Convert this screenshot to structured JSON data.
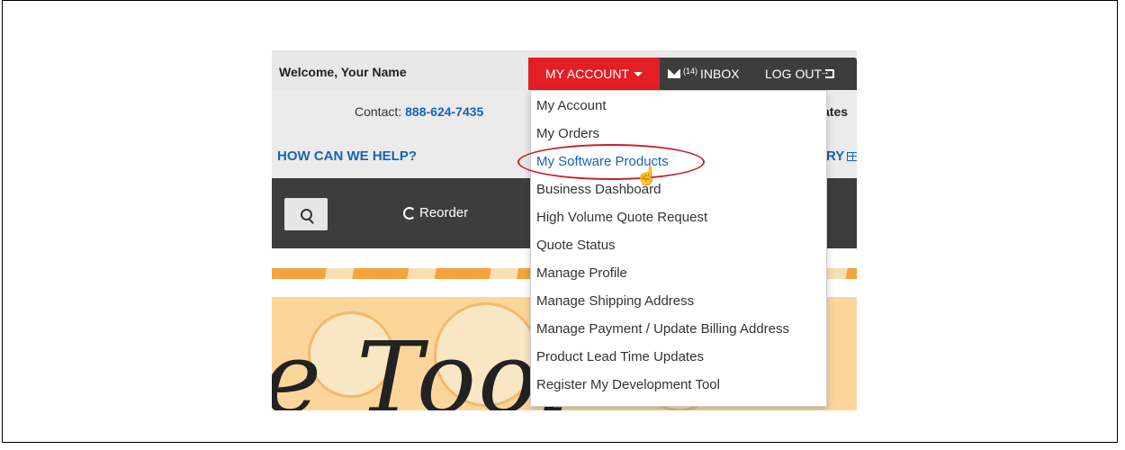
{
  "header": {
    "welcome": "Welcome, Your Name",
    "my_account_label": "MY ACCOUNT",
    "inbox_count": "(14)",
    "inbox_label": "INBOX",
    "logout_label": "LOG OUT",
    "contact_label": "Contact:",
    "contact_phone": "888-624-7435",
    "right_fragment": "ates",
    "help_label": "HOW CAN WE HELP?",
    "right_help_fragment": "RY"
  },
  "toolbar": {
    "reorder_label": "Reorder"
  },
  "banner": {
    "text": "e Tool"
  },
  "dropdown": {
    "items": [
      "My Account",
      "My Orders",
      "My Software Products",
      "Business Dashboard",
      "High Volume Quote Request",
      "Quote Status",
      "Manage Profile",
      "Manage Shipping Address",
      "Manage Payment / Update Billing Address",
      "Product Lead Time Updates",
      "Register My Development Tool"
    ],
    "highlighted_index": 2
  },
  "colors": {
    "accent_red": "#e31e24",
    "link_blue": "#1a62b5",
    "dark_bar": "#3d3d3d"
  }
}
